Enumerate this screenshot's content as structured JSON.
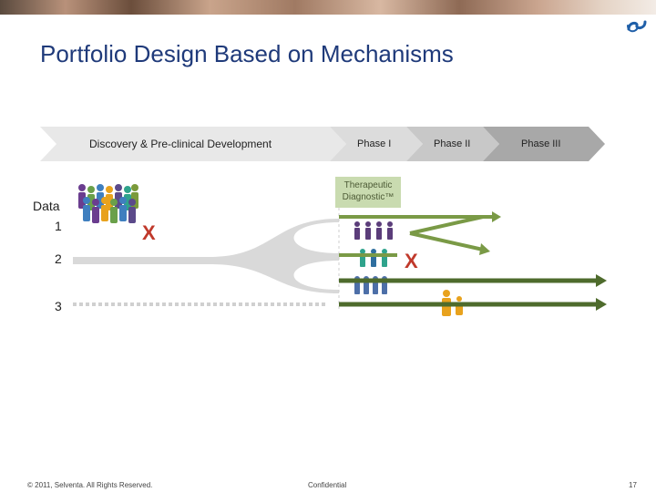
{
  "title": "Portfolio Design Based on Mechanisms",
  "phases": {
    "discovery": "Discovery & Pre-clinical Development",
    "phase1": "Phase I",
    "phase2": "Phase II",
    "phase3": "Phase III"
  },
  "rows": {
    "data_label": "Data",
    "row1": "1",
    "row2": "2",
    "row3": "3"
  },
  "therapeutic_label": "Therapeutic Diagnostic™",
  "fail_mark": "X",
  "colors": {
    "title": "#1f3a7a",
    "arrow_green": "#4e6b2c",
    "arrow_light_green": "#7a9a46",
    "fail_red": "#c0392b",
    "funnel_grey": "#d9d9d9"
  },
  "footer": {
    "copyright": "© 2011, Selventa. All Rights Reserved.",
    "confidential": "Confidential",
    "page": "17"
  },
  "logo_icon": "selventa-logo-icon"
}
